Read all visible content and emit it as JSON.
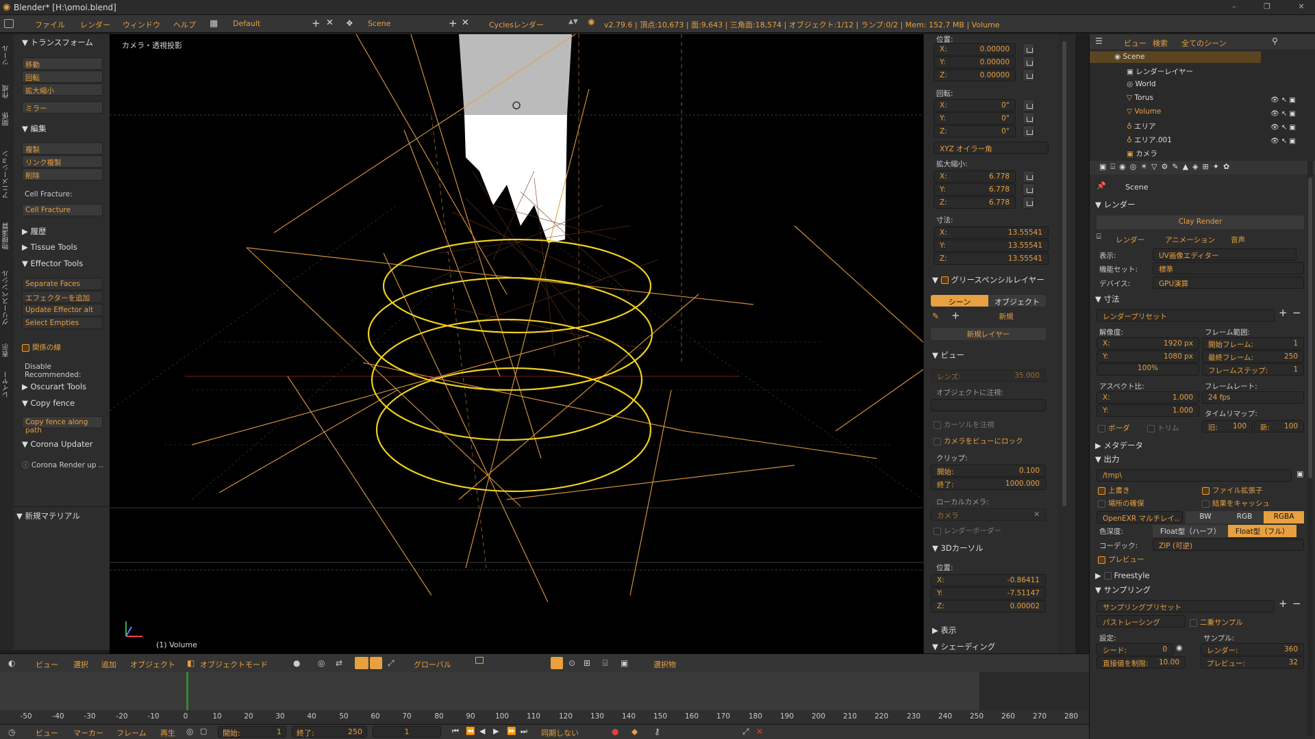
{
  "window": {
    "title": "Blender* [H:\\omoi.blend]",
    "min": "–",
    "max": "❐",
    "close": "✕"
  },
  "infobar": {
    "menus": [
      "ファイル",
      "レンダー",
      "ウィンドウ",
      "ヘルプ"
    ],
    "layout": "Default",
    "scene": "Scene",
    "engine": "Cyclesレンダー",
    "stats": "v2.79.6 | 頂点:10,673 | 面:9,643 | 三角面:18,574 | オブジェクト:1/12 | ランプ:0/2 | Mem: 152.7 MB | Volume"
  },
  "left_tabs": [
    "ツール",
    "作成",
    "関係",
    "アニメーション",
    "物理演算",
    "グリースペンシル",
    "表示",
    "レイヤー"
  ],
  "tool": {
    "transform_header": "トランスフォーム",
    "transform_items": [
      "移動",
      "回転",
      "拡大縮小"
    ],
    "mirror": "ミラー",
    "edit_header": "編集",
    "edit_items": [
      "複製",
      "リンク複製",
      "削除"
    ],
    "cell_label": "Cell Fracture:",
    "cell_btn": "Cell Fracture",
    "history": "履歴",
    "tissue": "Tissue Tools",
    "effector": "Effector Tools",
    "effector_items": [
      "Separate Faces",
      "エフェクターを追加",
      "Update Effector alt",
      "Select Empties"
    ],
    "relation_line": "関係の線",
    "disable": "Disable Recommended:",
    "oscurart": "Oscurart Tools",
    "copyfence": "Copy fence",
    "copyfence_btn": "Copy fence along path",
    "corona": "Corona Updater",
    "corona_item": "Corona Render up ‥",
    "new_material": "新規マテリアル"
  },
  "viewport": {
    "label": "カメラ・透視投影",
    "object": "(1) Volume"
  },
  "npanel": {
    "loc_label": "位置:",
    "loc": [
      {
        "k": "X:",
        "v": "0.00000"
      },
      {
        "k": "Y:",
        "v": "0.00000"
      },
      {
        "k": "Z:",
        "v": "0.00000"
      }
    ],
    "rot_label": "回転:",
    "rot": [
      {
        "k": "X:",
        "v": "0°"
      },
      {
        "k": "Y:",
        "v": "0°"
      },
      {
        "k": "Z:",
        "v": "0°"
      }
    ],
    "rot_mode": "XYZ オイラー角",
    "scale_label": "拡大縮小:",
    "scale": [
      {
        "k": "X:",
        "v": "6.778"
      },
      {
        "k": "Y:",
        "v": "6.778"
      },
      {
        "k": "Z:",
        "v": "6.778"
      }
    ],
    "dim_label": "寸法:",
    "dim": [
      {
        "k": "X:",
        "v": "13.55541"
      },
      {
        "k": "Y:",
        "v": "13.55541"
      },
      {
        "k": "Z:",
        "v": "13.55541"
      }
    ],
    "gp_header": "グリースペンシルレイヤー",
    "gp_scene": "シーン",
    "gp_object": "オブジェクト",
    "gp_new": "新規",
    "gp_new_layer": "新規レイヤー",
    "view_header": "ビュー",
    "lens_label": "レンズ:",
    "lens": "35.000",
    "lock_obj": "オブジェクトに注視:",
    "lock_cursor": "カーソルを注視",
    "lock_cam": "カメラをビューにロック",
    "clip_label": "クリップ:",
    "clip_start_k": "開始:",
    "clip_start": "0.100",
    "clip_end_k": "終了:",
    "clip_end": "1000.000",
    "local_cam": "ローカルカメラ:",
    "local_cam_val": "カメラ",
    "render_border": "レンダーボーダー",
    "cursor_header": "3Dカーソル",
    "cursor_loc": "位置:",
    "cursor": [
      {
        "k": "X:",
        "v": "-0.86411"
      },
      {
        "k": "Y:",
        "v": "-7.51147"
      },
      {
        "k": "Z:",
        "v": "0.00002"
      }
    ],
    "display": "表示",
    "shading": "シェーディング"
  },
  "view3d_header": {
    "items": [
      "ビュー",
      "選択",
      "追加",
      "オブジェクト"
    ],
    "mode": "オブジェクトモード",
    "orient": "グローバル",
    "select": "選択物"
  },
  "timeline": {
    "ticks": [
      "-50",
      "-40",
      "-30",
      "-20",
      "-10",
      "0",
      "10",
      "20",
      "30",
      "40",
      "50",
      "60",
      "70",
      "80",
      "90",
      "100",
      "110",
      "120",
      "130",
      "140",
      "150",
      "160",
      "170",
      "180",
      "190",
      "200",
      "210",
      "220",
      "230",
      "240",
      "250",
      "260",
      "270",
      "280"
    ],
    "menus": [
      "ビュー",
      "マーカー",
      "フレーム",
      "再生"
    ],
    "start_k": "開始:",
    "start": "1",
    "end_k": "終了:",
    "end": "250",
    "current": "1",
    "sync": "同期しない"
  },
  "outliner": {
    "menus": [
      "ビュー",
      "検索",
      "全てのシーン"
    ],
    "items": [
      {
        "name": "Scene"
      },
      {
        "name": "レンダーレイヤー"
      },
      {
        "name": "World"
      },
      {
        "name": "Torus"
      },
      {
        "name": "Volume"
      },
      {
        "name": "エリア"
      },
      {
        "name": "エリア.001"
      },
      {
        "name": "カメラ"
      }
    ]
  },
  "props": {
    "scene": "Scene",
    "render_header": "レンダー",
    "clay": "Clay Render",
    "tab_render": "レンダー",
    "tab_anim": "アニメーション",
    "tab_audio": "音声",
    "display_k": "表示:",
    "display_v": "UV画像エディター",
    "featureset_k": "機能セット:",
    "featureset_v": "標準",
    "device_k": "デバイス:",
    "device_v": "GPU演算",
    "dim_header": "寸法",
    "preset": "レンダープリセット",
    "res_label": "解像度:",
    "res_x_k": "X:",
    "res_x": "1920 px",
    "res_y_k": "Y:",
    "res_y": "1080 px",
    "res_pct": "100%",
    "frame_range": "フレーム範囲:",
    "fstart_k": "開始フレーム:",
    "fstart": "1",
    "fend_k": "最終フレーム:",
    "fend": "250",
    "fstep_k": "フレームステップ:",
    "fstep": "1",
    "aspect": "アスペクト比:",
    "asp_x_k": "X:",
    "asp_x": "1.000",
    "asp_y_k": "Y:",
    "asp_y": "1.000",
    "framerate": "フレームレート:",
    "fps": "24 fps",
    "border": "ボーダ",
    "crop": "トリム",
    "timemap": "タイムリマップ:",
    "old_k": "旧:",
    "old": "100",
    "new_k": "新:",
    "new": "100",
    "metadata": "メタデータ",
    "output": "出力",
    "path": "/tmp\\",
    "overwrite": "上書き",
    "ext": "ファイル拡張子",
    "placeholder": "場所の確保",
    "cache": "結果をキャッシュ",
    "format": "OpenEXR マルチレイ‥",
    "bw": "BW",
    "rgb": "RGB",
    "rgba": "RGBA",
    "depth_k": "色深度:",
    "half": "Float型（ハーフ）",
    "full": "Float型（フル）",
    "codec_k": "コーデック:",
    "codec": "ZIP (可逆)",
    "preview": "プレビュー",
    "freestyle": "Freestyle",
    "sampling": "サンプリング",
    "samp_preset": "サンプリングプリセット",
    "integrator": "パストレーシング",
    "square": "二乗サンプル",
    "settings": "設定:",
    "samples": "サンプル:",
    "seed_k": "シード:",
    "seed": "0",
    "clamp_k": "直接値を制限:",
    "clamp": "10.00",
    "render_samples_k": "レンダー:",
    "render_samples": "360",
    "preview_samples_k": "プレビュー:",
    "preview_samples": "32"
  },
  "colors": {
    "accent": "#e8a040",
    "bg": "#1e1e1e",
    "panel": "#2d2d2d",
    "viewport": "#000000",
    "yellow_ring": "#f0d020"
  }
}
